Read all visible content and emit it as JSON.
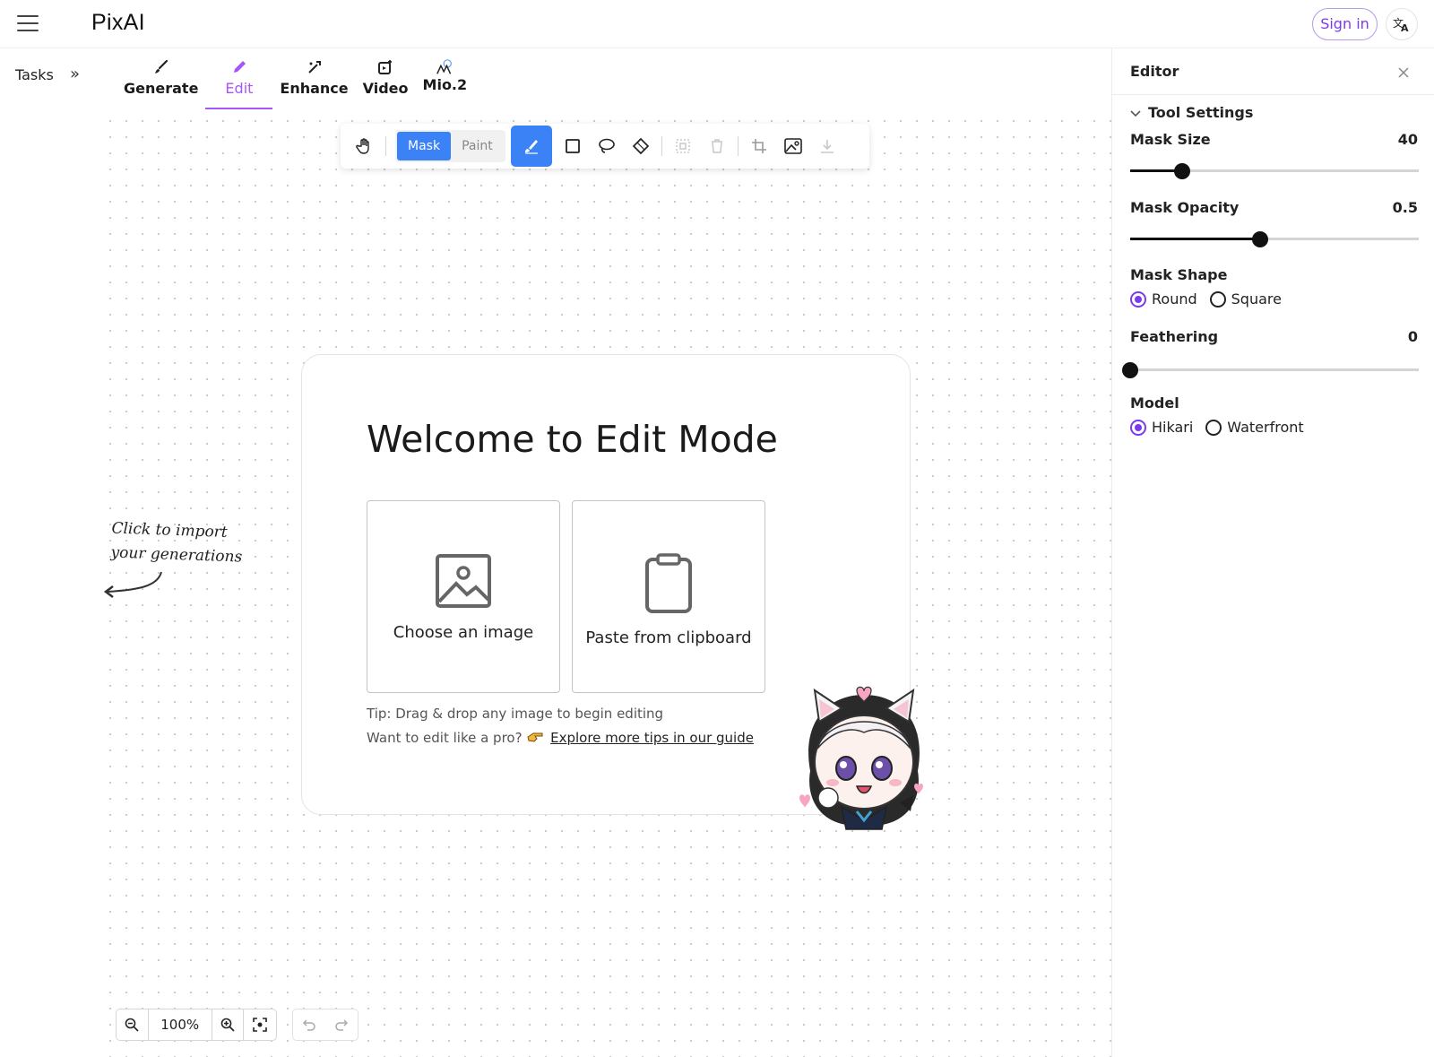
{
  "app": {
    "logo": "PixAI",
    "sign_in": "Sign in",
    "translate_icon": "translate-icon"
  },
  "tasks": {
    "label": "Tasks",
    "expand": "»"
  },
  "nav": {
    "tabs": [
      {
        "label": "Generate",
        "icon": "brush-icon"
      },
      {
        "label": "Edit",
        "icon": "pencil-icon",
        "active": true
      },
      {
        "label": "Enhance",
        "icon": "enhance-icon"
      },
      {
        "label": "Video",
        "icon": "video-icon"
      },
      {
        "label": "Mio.2",
        "icon": "mio-icon"
      }
    ]
  },
  "toolbar": {
    "mode_mask": "Mask",
    "mode_paint": "Paint",
    "active_mode": "Mask",
    "icons": [
      "hand-icon",
      "brush-icon",
      "rectangle-icon",
      "lasso-icon",
      "eraser-icon",
      "select-icon",
      "trash-icon",
      "crop-icon",
      "image-icon",
      "download-icon"
    ]
  },
  "welcome": {
    "title": "Welcome to Edit Mode",
    "choose_image": "Choose an image",
    "paste_clipboard": "Paste from clipboard",
    "tip": "Tip: Drag & drop any image to begin editing",
    "pro_prefix": "Want to edit like a pro?",
    "guide_link": "Explore more tips in our guide"
  },
  "hint": {
    "line1": "Click to import",
    "line2": "your generations"
  },
  "zoom": {
    "level": "100%"
  },
  "editor": {
    "title": "Editor",
    "section": "Tool Settings",
    "mask_size": {
      "label": "Mask Size",
      "value": "40",
      "fraction": 0.18
    },
    "mask_opacity": {
      "label": "Mask Opacity",
      "value": "0.5",
      "fraction": 0.45
    },
    "mask_shape": {
      "label": "Mask Shape",
      "options": [
        "Round",
        "Square"
      ],
      "selected": "Round"
    },
    "feathering": {
      "label": "Feathering",
      "value": "0",
      "fraction": 0
    },
    "model": {
      "label": "Model",
      "options": [
        "Hikari",
        "Waterfront"
      ],
      "selected": "Hikari"
    }
  },
  "colors": {
    "accent": "#a855f7",
    "brand_purple": "#7c3aed",
    "tool_blue": "#3b82f6"
  }
}
